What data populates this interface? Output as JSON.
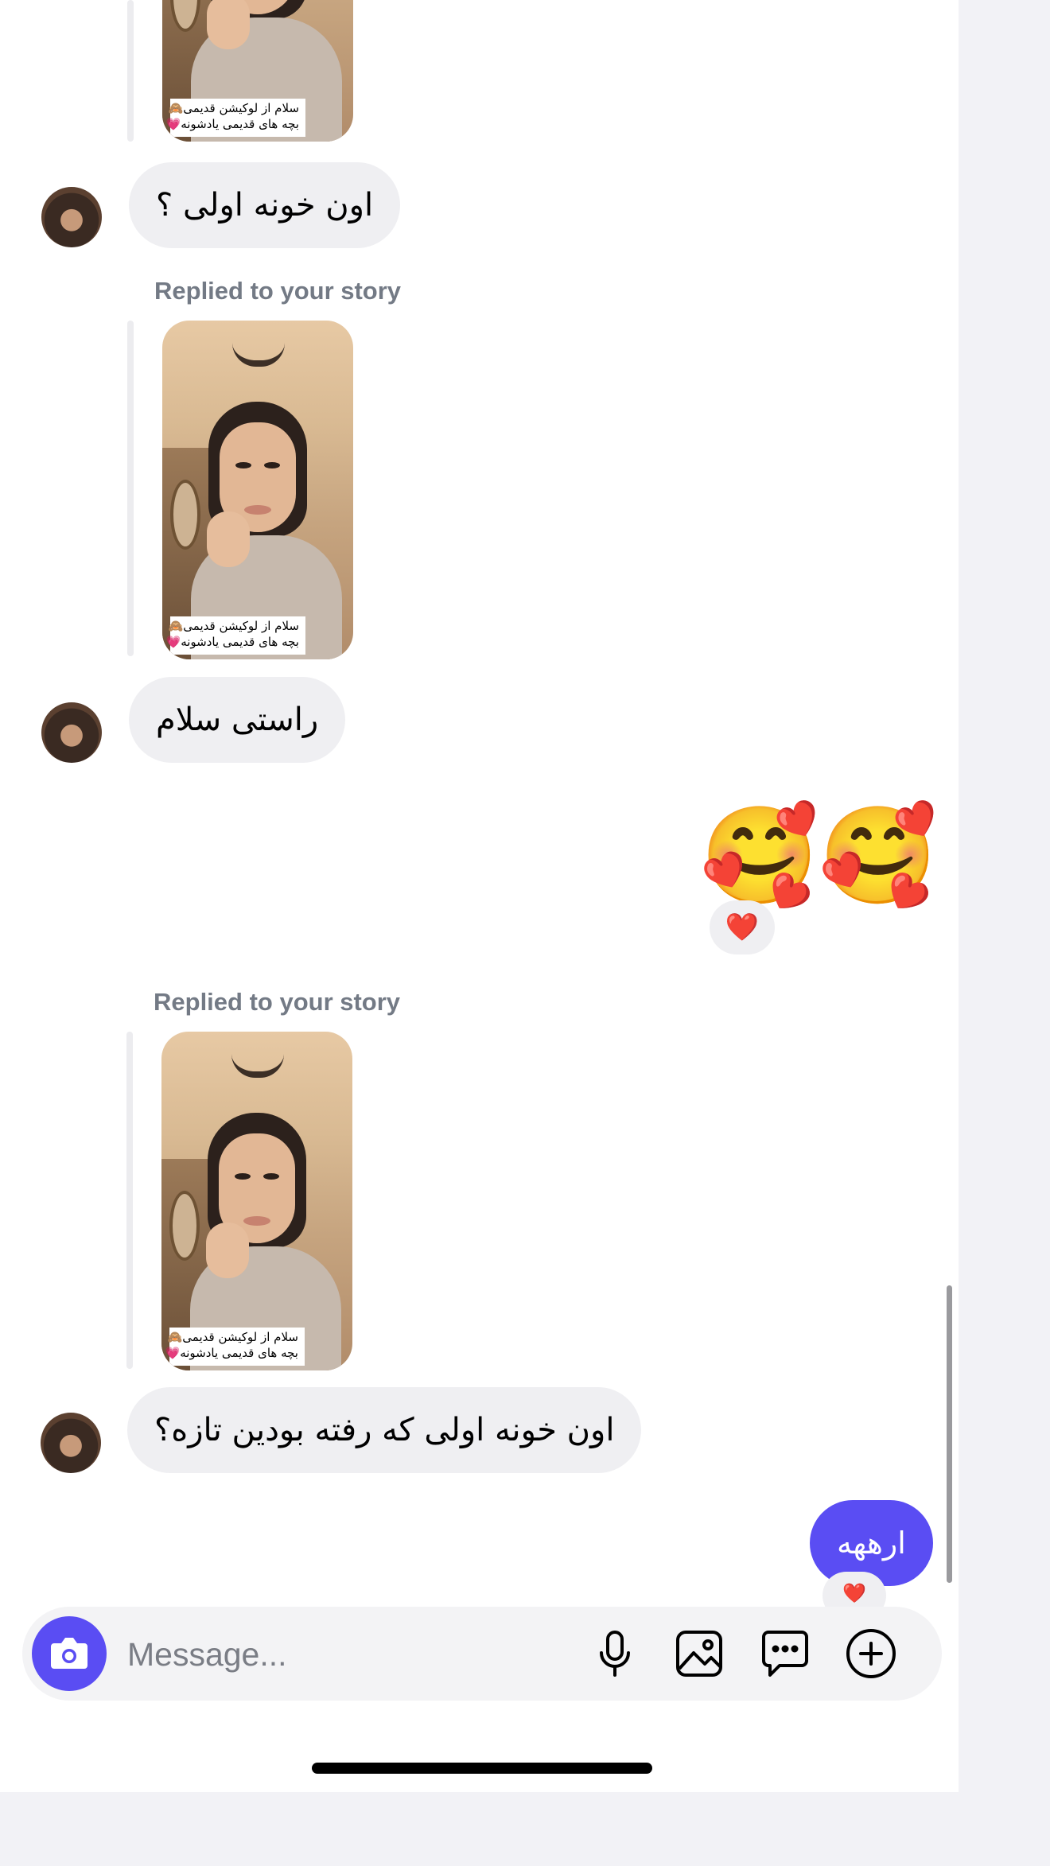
{
  "story": {
    "replied_label": "Replied to your story",
    "caption_line1": "سلام از لوکیشن قدیمی🙈",
    "caption_line2": "بچه های قدیمی یادشونه💗"
  },
  "messages": {
    "m1": "اون خونه اولی ؟",
    "m2": "راستی سلام",
    "emoji": "🥰🥰",
    "emoji_reaction": "❤️",
    "m3": "اون خونه اولی که رفته بودین تازه؟",
    "sent": "ارههه",
    "sent_reaction": "❤️"
  },
  "composer": {
    "placeholder": "Message...",
    "icons": [
      "camera-icon",
      "microphone-icon",
      "gallery-icon",
      "sticker-chat-icon",
      "add-icon"
    ]
  },
  "colors": {
    "accent": "#5a4df3",
    "incoming_bubble": "#efeff2",
    "label_gray": "#737a85"
  }
}
